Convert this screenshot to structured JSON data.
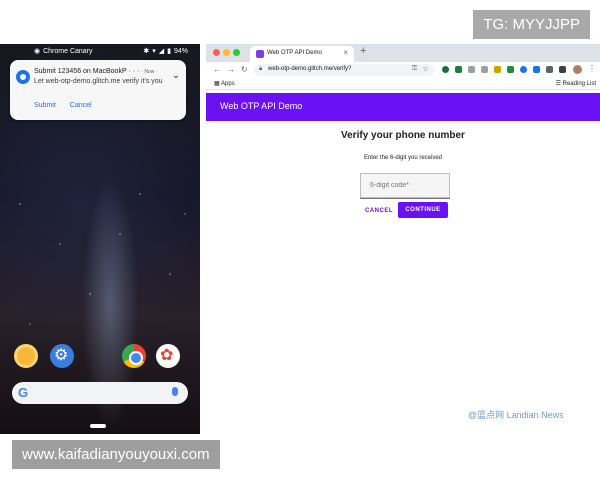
{
  "badges": {
    "top": "TG: MYYJJPP",
    "bottom": "www.kaifadianyouyouxi.com"
  },
  "phone": {
    "statusbar": {
      "app_name": "Chrome Canary",
      "battery": "94%"
    },
    "notification": {
      "title": "Submit 123456 on MacBookP · · ·",
      "meta": "· Now ·",
      "body": "Let web-otp-demo.glitch.me verify it's you",
      "actions": [
        "Submit",
        "Cancel"
      ]
    },
    "icons": {
      "home_apps": [
        "app-icon",
        "settings-icon",
        "chrome-icon",
        "photos-icon"
      ],
      "search_bar": [
        "google-icon",
        "mic-icon"
      ]
    }
  },
  "browser": {
    "tab_title": "Web OTP API Demo",
    "url": "web-otp-demo.glitch.me/verify?",
    "bookmarks": {
      "apps": "Apps",
      "reading_list": "Reading List"
    },
    "page": {
      "appbar_title": "Web OTP API Demo",
      "heading": "Verify your phone number",
      "subtext": "Enter the 6-digit you received",
      "input_placeholder": "6-digit code*",
      "cancel_label": "CANCEL",
      "continue_label": "CONTINUE"
    },
    "watermark": "@蓝点网 Landian.News"
  }
}
